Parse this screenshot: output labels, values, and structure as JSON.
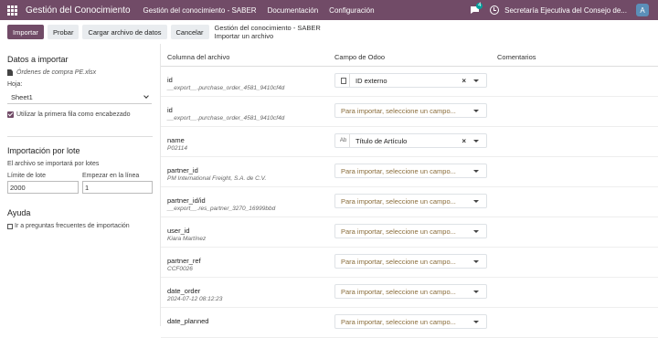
{
  "navbar": {
    "app_name": "Gestión del Conocimiento",
    "menu": [
      "Gestión del conocimiento - SABER",
      "Documentación",
      "Configuración"
    ],
    "chat_badge": "4",
    "company": "Secretaría Ejecutiva del Consejo de...",
    "avatar": "A"
  },
  "control": {
    "import_label": "Importar",
    "test_label": "Probar",
    "load_label": "Cargar archivo de datos",
    "cancel_label": "Cancelar",
    "breadcrumb_parent": "Gestión del conocimiento - SABER",
    "breadcrumb_current": "Importar un archivo"
  },
  "sidebar": {
    "data_title": "Datos a importar",
    "file_name": "Órdenes de compra PE.xlsx",
    "sheet_label": "Hoja:",
    "sheet_value": "Sheet1",
    "header_checkbox_label": "Utilizar la primera fila como encabezado",
    "batch_title": "Importación por lote",
    "batch_desc": "El archivo se importará por lotes",
    "limit_label": "Límite de lote",
    "start_label": "Empezar en la línea",
    "limit_value": "2000",
    "start_value": "1",
    "help_title": "Ayuda",
    "help_link": "Ir a preguntas frecuentes de importación"
  },
  "table": {
    "headers": [
      "Columna del archivo",
      "Campo de Odoo",
      "Comentarios"
    ],
    "placeholder": "Para importar, seleccione un campo...",
    "rows": [
      {
        "name": "id",
        "sample": "__export__.purchase_order_4581_9410cf4d",
        "field": "ID externo",
        "icon": "doc"
      },
      {
        "name": "id",
        "sample": "__export__.purchase_order_4581_9410cf4d",
        "field": "",
        "icon": ""
      },
      {
        "name": "name",
        "sample": "P02114",
        "field": "Título de Artículo",
        "icon": "Ab"
      },
      {
        "name": "partner_id",
        "sample": "PM International Freight, S.A. de C.V.",
        "field": "",
        "icon": ""
      },
      {
        "name": "partner_id/id",
        "sample": "__export__.res_partner_3270_16999bbd",
        "field": "",
        "icon": ""
      },
      {
        "name": "user_id",
        "sample": "Kiara Martínez",
        "field": "",
        "icon": ""
      },
      {
        "name": "partner_ref",
        "sample": "CCF0026",
        "field": "",
        "icon": ""
      },
      {
        "name": "date_order",
        "sample": "2024-07-12 08:12:23",
        "field": "",
        "icon": ""
      },
      {
        "name": "date_planned",
        "sample": "",
        "field": "",
        "icon": ""
      }
    ]
  }
}
